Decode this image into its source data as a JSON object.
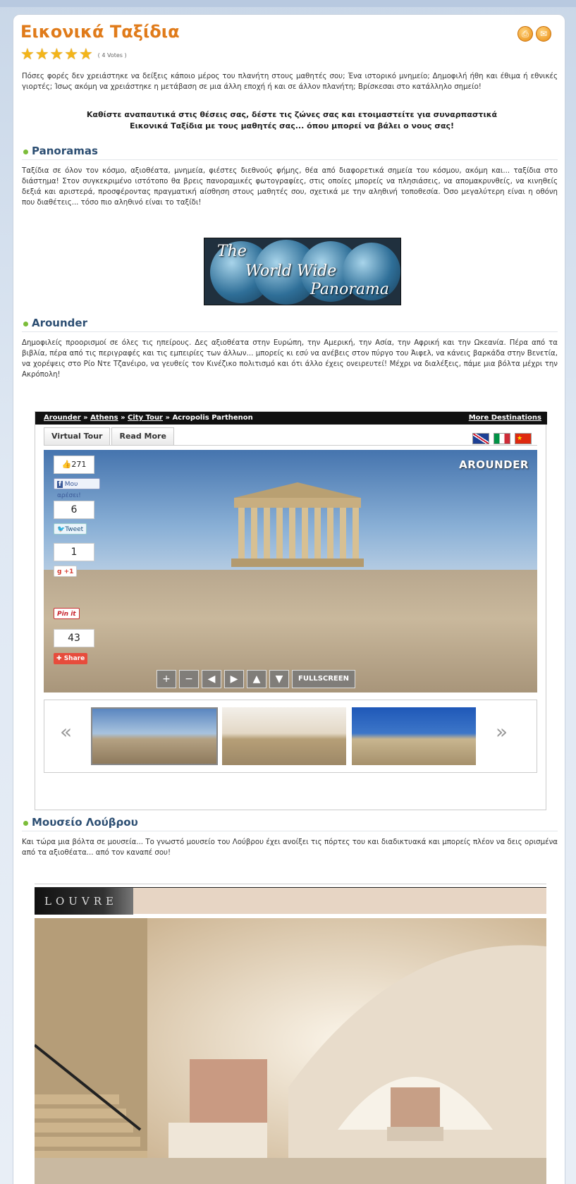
{
  "page": {
    "title": "Εικονικά Ταξίδια",
    "votes": "( 4 Votes )",
    "intro": "Πόσες φορές δεν χρειάστηκε να δείξεις κάποιο μέρος του πλανήτη στους μαθητές σου; Ένα ιστορικό μνημείο; Δημοφιλή ήθη και έθιμα ή εθνικές γιορτές; Ίσως ακόμη να χρειάστηκε η μετάβαση σε μια άλλη εποχή ή και σε άλλον πλανήτη; Βρίσκεσαι στο κατάλληλο σημείο!",
    "callout": "Καθίστε αναπαυτικά στις θέσεις σας, δέστε τις ζώνες σας και ετοιμαστείτε για συναρπαστικά Εικονικά Ταξίδια με τους μαθητές σας... όπου μπορεί να βάλει ο νους σας!"
  },
  "sections": {
    "panoramas": {
      "heading": "Panoramas",
      "text": "Ταξίδια σε όλον τον κόσμο, αξιοθέατα, μνημεία, φιέστες διεθνούς φήμης, θέα από διαφορετικά σημεία του κόσμου, ακόμη και... ταξίδια στο διάστημα! Στον συγκεκριμένο ιστότοπο θα βρεις πανοραμικές φωτογραφίες, στις οποίες μπορείς να πλησιάσεις, να απομακρυνθείς, να κινηθείς δεξιά και αριστερά, προσφέροντας πραγματική αίσθηση στους μαθητές σου, σχετικά με την αληθινή τοποθεσία. Όσο μεγαλύτερη είναι η οθόνη που διαθέτεις... τόσο πιο αληθινό είναι το ταξίδι!",
      "banner_line1": "The",
      "banner_line2": "World Wide",
      "banner_line3": "Panorama"
    },
    "arounder": {
      "heading": "Arounder",
      "text": "Δημοφιλείς προορισμοί σε όλες τις ηπείρους. Δες αξιοθέατα στην Ευρώπη, την Αμερική, την Ασία, την Αφρική και την Ωκεανία. Πέρα από τα βιβλία, πέρα από τις περιγραφές και τις εμπειρίες των άλλων... μπορείς κι εσύ να ανέβεις στον πύργο του Άιφελ, να κάνεις βαρκάδα στην Βενετία, να χορέψεις στο Ρίο Ντε Τζανέιρο, να γευθείς τον Κινέζικο πολιτισμό και ότι άλλο έχεις ονειρευτεί! Μέχρι να διαλέξεις, πάμε μια βόλτα μέχρι την Ακρόπολη!"
    },
    "louvre": {
      "heading": "Μουσείο Λούβρου",
      "text": "Και τώρα μια βόλτα σε μουσεία... Το γνωστό μουσείο του Λούβρου έχει ανοίξει τις πόρτες του και διαδικτυακά και μπορείς πλέον να δεις ορισμένα από τα αξιοθέατα... από τον καναπέ σου!",
      "logo_text": "LOUVRE"
    }
  },
  "widget": {
    "crumb_1": "Arounder",
    "crumb_sep": "»",
    "crumb_2": "Athens",
    "crumb_3": "City Tour",
    "crumb_4": "Acropolis Parthenon",
    "more": "More Destinations",
    "tab_virtual": "Virtual Tour",
    "tab_read": "Read More",
    "brand": "AROUNDER",
    "fullscreen": "FULLSCREEN",
    "like_count": "271",
    "like_label": "Μου αρέσει!",
    "tweet_count": "6",
    "tweet_label": "Tweet",
    "gplus_count": "1",
    "gplus_label": "+1",
    "pin_label": "Pin it",
    "share_count": "43",
    "share_label": "Share"
  },
  "colors": {
    "title_orange": "#e07b1a",
    "heading_blue": "#2d4f73",
    "bullet_green": "#7cbd3a"
  }
}
